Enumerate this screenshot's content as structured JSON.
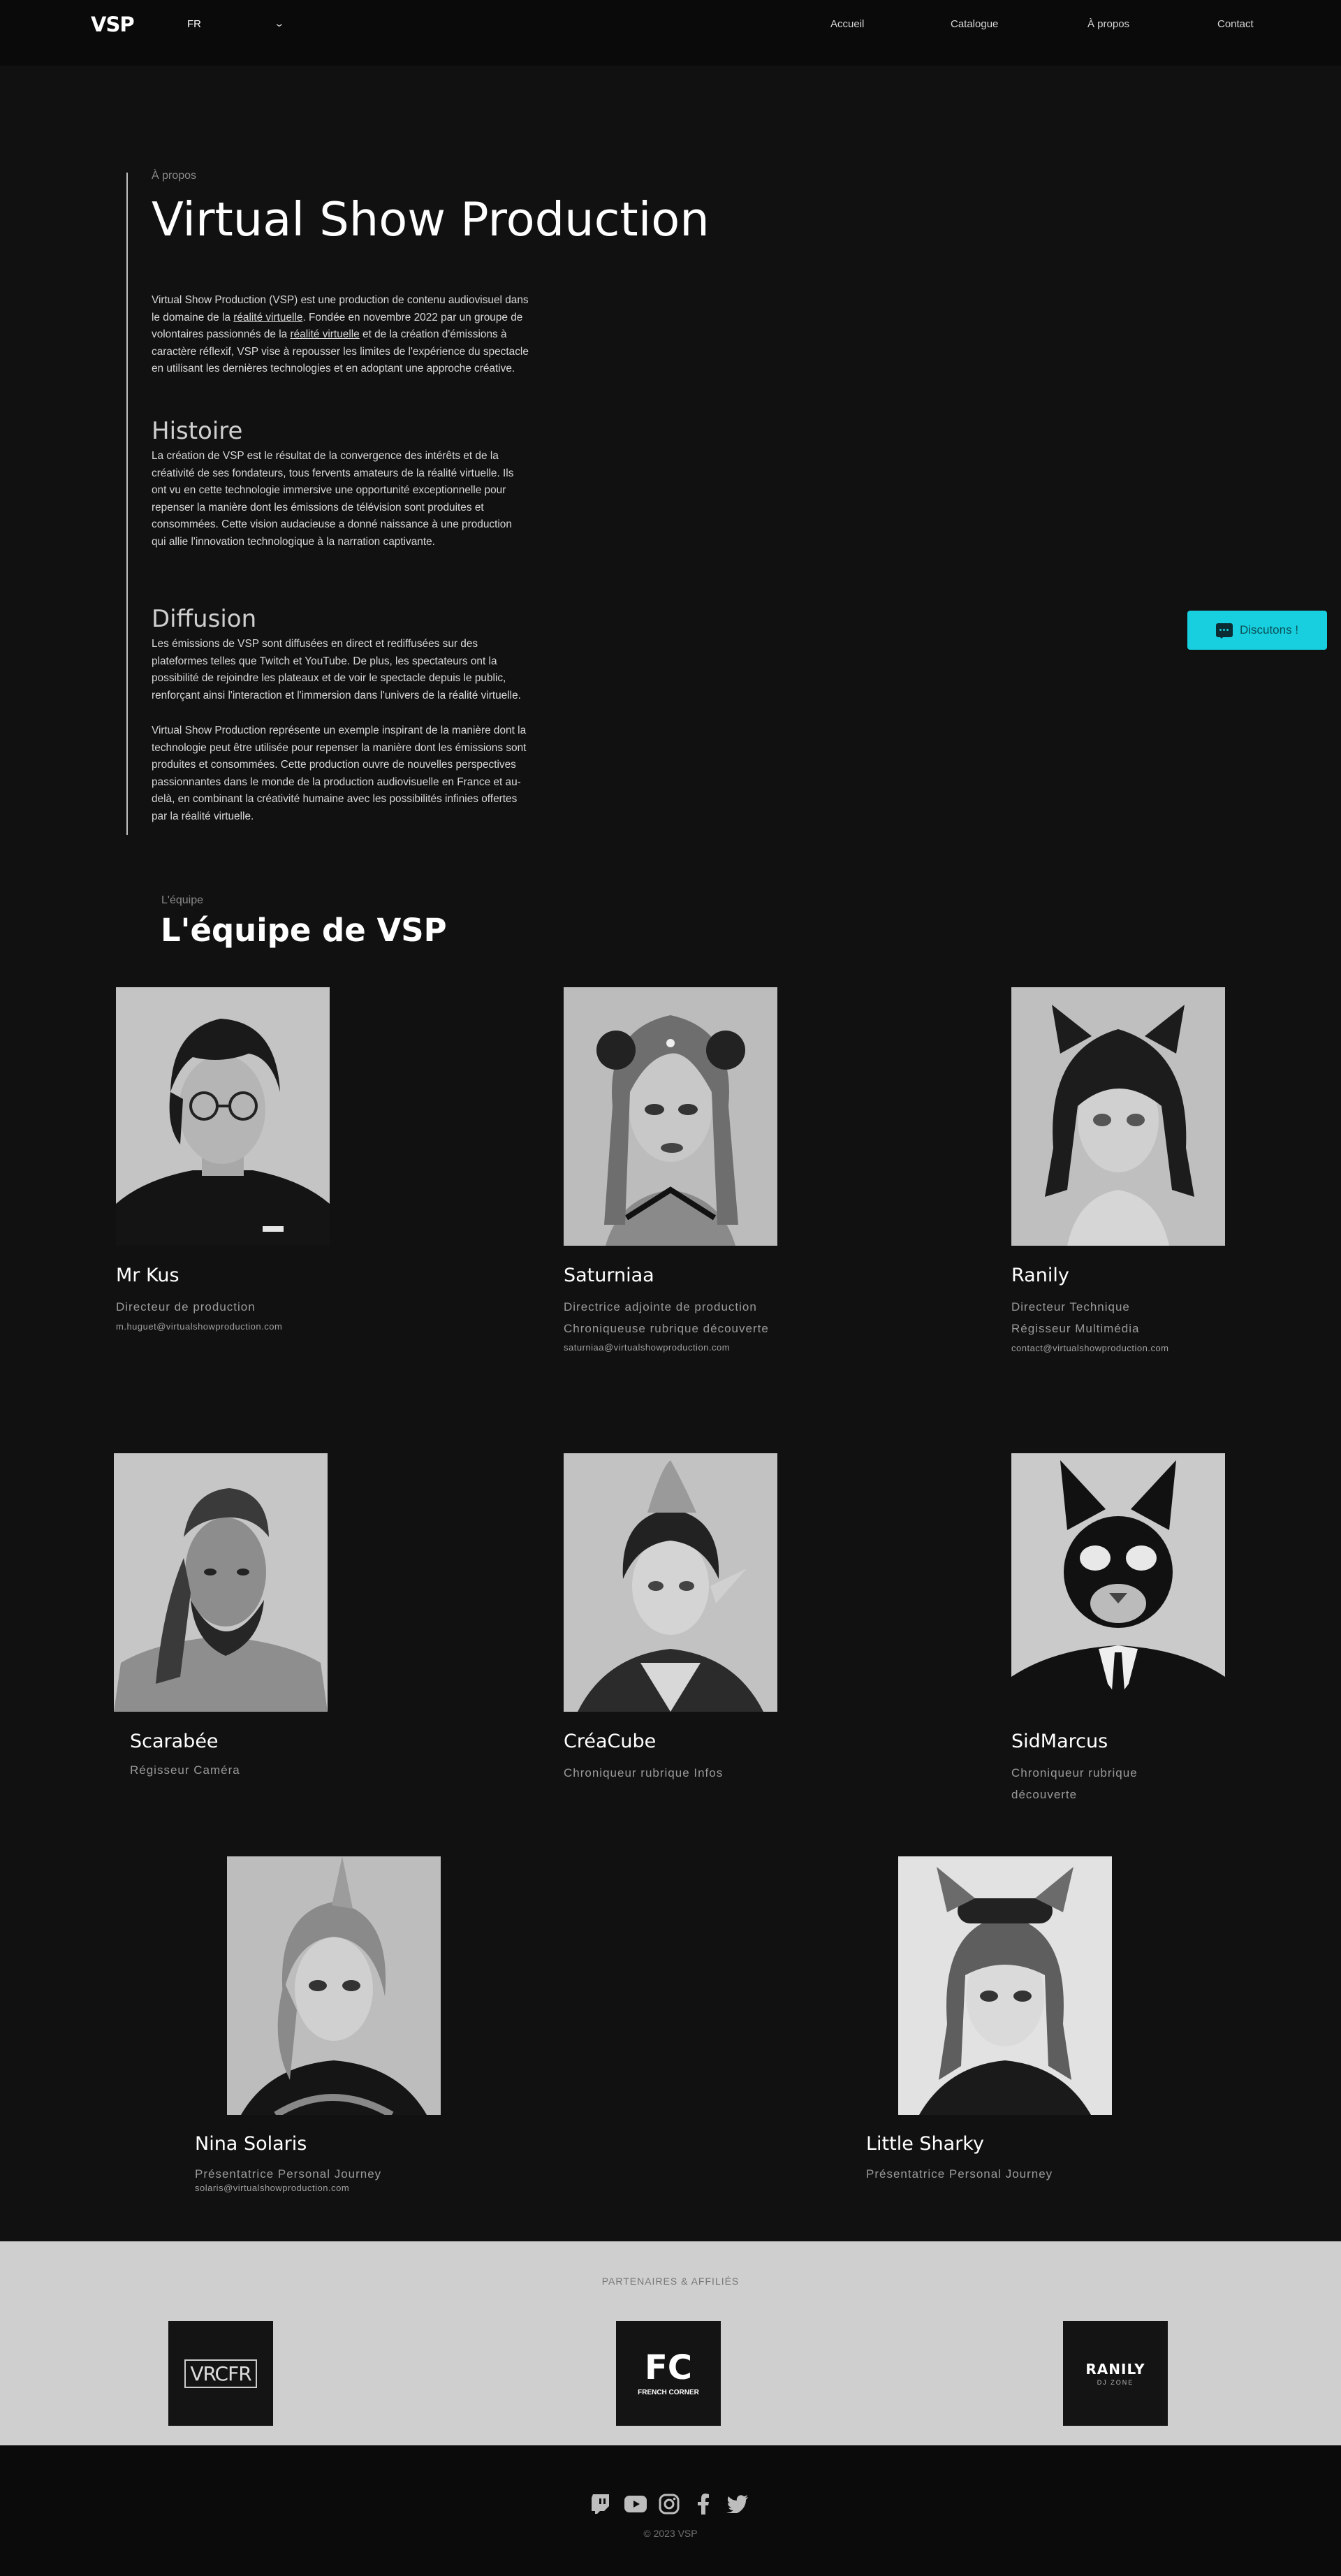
{
  "header": {
    "logo": "VSP",
    "language": "FR",
    "nav": [
      "Accueil",
      "Catalogue",
      "À propos",
      "Contact"
    ]
  },
  "about": {
    "kicker": "À propos",
    "title": "Virtual Show Production",
    "intro": {
      "p1": "Virtual Show Production (VSP) est une production de contenu audiovisuel dans le domaine de la ",
      "link1": "réalité virtuelle",
      "p2": ". Fondée en novembre 2022 par un groupe de volontaires passionnés de la ",
      "link2": "réalité virtuelle",
      "p3": " et de la création d'émissions à caractère réflexif, VSP vise à repousser les limites de l'expérience du spectacle en utilisant les dernières technologies et en adoptant une approche créative."
    },
    "history_title": "Histoire",
    "history_text": "La création de VSP est le résultat de la convergence des intérêts et de la créativité de ses fondateurs, tous fervents amateurs de la réalité virtuelle. Ils ont vu en cette technologie immersive une opportunité exceptionnelle pour repenser la manière dont les émissions de télévision sont produites et consommées. Cette vision audacieuse a donné naissance à une production qui allie l'innovation technologique à la narration captivante.",
    "diffusion_title": "Diffusion",
    "diffusion_text_1": "Les émissions de VSP sont diffusées en direct et rediffusées sur des plateformes telles que Twitch et YouTube. De plus, les spectateurs ont la possibilité de rejoindre les plateaux et de voir le spectacle depuis le public, renforçant ainsi l'interaction et l'immersion dans l'univers de la réalité virtuelle.",
    "diffusion_text_2": "Virtual Show Production représente un exemple inspirant de la manière dont la technologie peut être utilisée pour repenser la manière dont les émissions sont produites et consommées. Cette production ouvre de nouvelles perspectives passionnantes dans le monde de la production audiovisuelle en France et au-delà, en combinant la créativité humaine avec les possibilités infinies offertes par la réalité virtuelle."
  },
  "team": {
    "kicker": "L'équipe",
    "title": "L'équipe de VSP",
    "members": [
      {
        "name": "Mr Kus",
        "roles": [
          "Directeur de production"
        ],
        "email": "m.huguet@virtualshowproduction.com"
      },
      {
        "name": "Saturniaa",
        "roles": [
          "Directrice adjointe de production",
          "Chroniqueuse rubrique découverte"
        ],
        "email": "saturniaa@virtualshowproduction.com"
      },
      {
        "name": "Ranily",
        "roles": [
          "Directeur Technique",
          "Régisseur Multimédia"
        ],
        "email": "contact@virtualshowproduction.com"
      },
      {
        "name": "Scarabée",
        "roles": [
          "Régisseur Caméra"
        ],
        "email": ""
      },
      {
        "name": "CréaCube",
        "roles": [
          "Chroniqueur rubrique Infos"
        ],
        "email": ""
      },
      {
        "name": "SidMarcus",
        "roles": [
          "Chroniqueur rubrique",
          "découverte"
        ],
        "email": ""
      },
      {
        "name": "Nina Solaris",
        "roles": [
          "Présentatrice Personal Journey"
        ],
        "email": "solaris@virtualshowproduction.com"
      },
      {
        "name": "Little Sharky",
        "roles": [
          "Présentatrice Personal Journey"
        ],
        "email": ""
      }
    ]
  },
  "chat_button": {
    "label": "Discutons !",
    "icon": "chat-icon"
  },
  "partners": {
    "title": "PARTENAIRES & AFFILIÉS",
    "logos": [
      {
        "text": "VRCFR"
      },
      {
        "text": "FC",
        "sub": "FRENCH CORNER"
      },
      {
        "text": "RANILY",
        "sub": "DJ ZONE"
      }
    ]
  },
  "footer": {
    "social": [
      "twitch-icon",
      "youtube-icon",
      "instagram-icon",
      "facebook-icon",
      "twitter-icon"
    ],
    "copyright": "© 2023 VSP"
  }
}
